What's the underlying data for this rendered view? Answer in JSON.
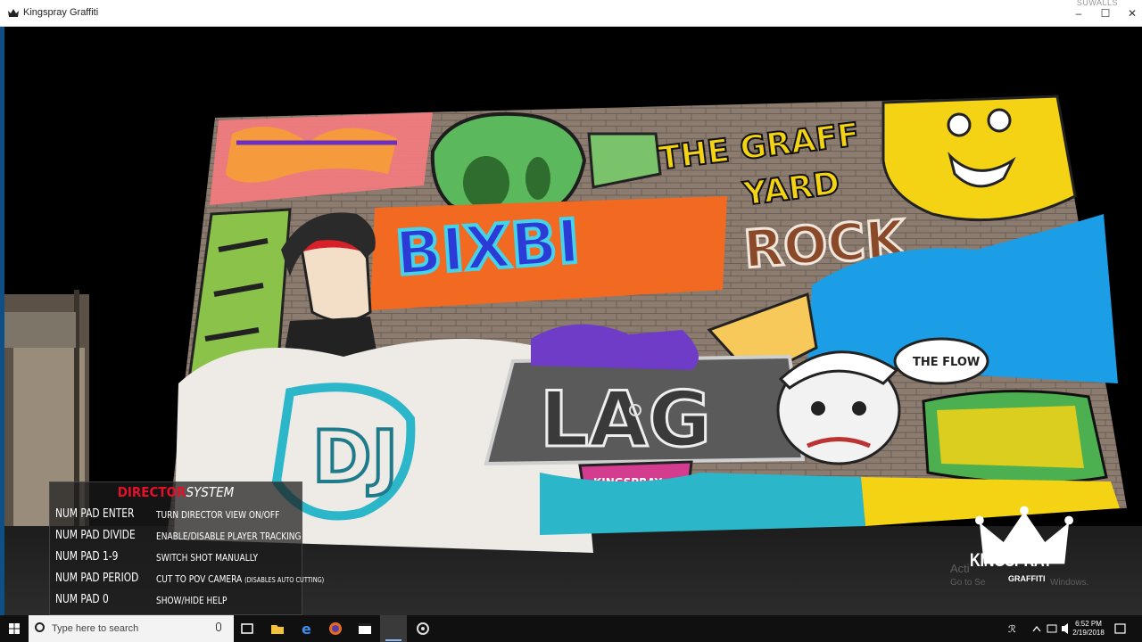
{
  "window": {
    "title": "Kingspray Graffiti",
    "top_watermark": "SUWALLS",
    "controls": {
      "minimize": "–",
      "maximize": "☐",
      "close": "✕"
    }
  },
  "director_help": {
    "heading_red": "DIRECTOR",
    "heading_white": "SYSTEM",
    "rows": [
      {
        "key": "NUM PAD ENTER",
        "action": "TURN DIRECTOR VIEW ON/OFF",
        "note": ""
      },
      {
        "key": "NUM PAD DIVIDE",
        "action": "ENABLE/DISABLE PLAYER TRACKING",
        "note": ""
      },
      {
        "key": "NUM PAD 1-9",
        "action": "SWITCH SHOT MANUALLY",
        "note": ""
      },
      {
        "key": "NUM PAD PERIOD",
        "action": "CUT TO POV CAMERA",
        "note": "(DISABLES AUTO CUTTING)"
      },
      {
        "key": "NUM PAD 0",
        "action": "SHOW/HIDE HELP",
        "note": ""
      }
    ]
  },
  "wall_art": {
    "texts": [
      "THE GRAFF",
      "YARD",
      "BIXBI",
      "ROCK",
      "LAG",
      "DJ",
      "THE FLOW",
      "KINGSPRAY"
    ]
  },
  "watermarks": {
    "activate": "Acti",
    "activate_sub": "Go to Se",
    "activate_sub_end": "Windows.",
    "brand": "KINGSPRAY",
    "brand_sub": "GRAFFITI"
  },
  "taskbar": {
    "search_placeholder": "Type here to search",
    "time": "6:52 PM",
    "date": "2/19/2018",
    "pinned": [
      "task-view",
      "file-explorer",
      "edge",
      "firefox",
      "app-window",
      "kingspray",
      "settings"
    ]
  },
  "colors": {
    "director_red": "#e3102a",
    "wall_brick": "#8c7b6f",
    "sky_blue": "#1b9ee6",
    "bixbi_blue": "#2c3bd6",
    "yellow": "#f4d315",
    "taskbar": "#101010"
  }
}
